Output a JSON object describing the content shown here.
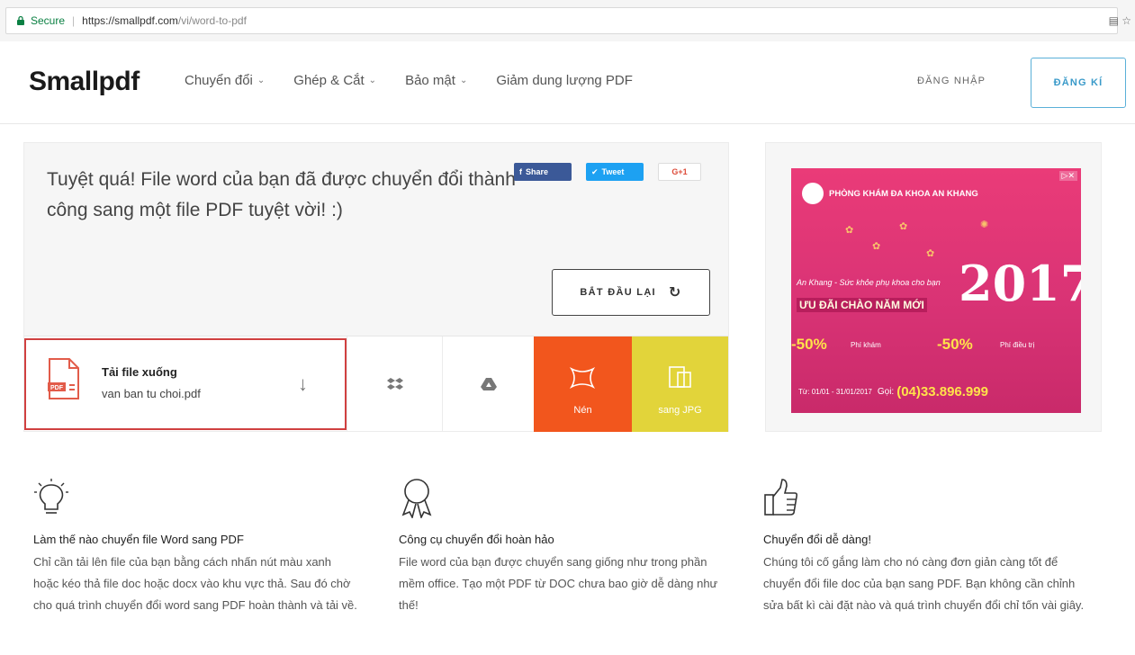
{
  "browser": {
    "secure_label": "Secure",
    "url_host": "https://smallpdf.com",
    "url_path": "/vi/word-to-pdf"
  },
  "header": {
    "logo": "Smallpdf",
    "nav": [
      {
        "label": "Chuyển đổi",
        "dropdown": true
      },
      {
        "label": "Ghép & Cắt",
        "dropdown": true
      },
      {
        "label": "Bảo mật",
        "dropdown": true
      },
      {
        "label": "Giảm dung lượng PDF",
        "dropdown": false
      }
    ],
    "login": "ĐĂNG NHẬP",
    "signup": "ĐĂNG KÍ"
  },
  "result": {
    "message": "Tuyệt quá! File word của bạn đã được chuyển đổi thành công sang một file PDF tuyệt vời! :)",
    "share": {
      "facebook": "Share",
      "twitter": "Tweet",
      "google": "G+1"
    },
    "restart_label": "BẮT ĐẦU LẠI",
    "download_title": "Tải file xuống",
    "file_name": "van ban tu choi.pdf",
    "compress_label": "Nén",
    "to_jpg_label": "sang JPG"
  },
  "ad": {
    "brand": "PHÒNG KHÁM ĐA KHOA AN KHANG",
    "tagline": "An Khang - Sức khỏe phụ khoa cho bạn",
    "promo": "ƯU ĐÃI CHÀO NĂM MỚI",
    "year": "2017",
    "discount1": "-50%",
    "discount1_note": "Phí khám",
    "discount2": "-50%",
    "discount2_note": "Phí điều trị",
    "dates": "Từ: 01/01 - 31/01/2017",
    "call_label": "Gọi:",
    "phone": "(04)33.896.999"
  },
  "features": [
    {
      "icon": "lightbulb-icon",
      "title": "Làm thế nào chuyển file Word sang PDF",
      "text": "Chỉ cần tải lên file của bạn bằng cách nhấn nút màu xanh hoặc kéo thả file doc hoặc docx vào khu vực thả. Sau đó chờ cho quá trình chuyển đổi word sang PDF hoàn thành và tải về."
    },
    {
      "icon": "award-ribbon-icon",
      "title": "Công cụ chuyển đổi hoàn hảo",
      "text": "File word của bạn được chuyển sang giống như trong phần mềm office. Tạo một PDF từ DOC chưa bao giờ dễ dàng như thế!"
    },
    {
      "icon": "thumbs-up-icon",
      "title": "Chuyển đổi dễ dàng!",
      "text": "Chúng tôi cố gắng làm cho nó càng đơn giản càng tốt để chuyển đổi file doc của bạn sang PDF. Bạn không cần chỉnh sửa bất kì cài đặt nào và quá trình chuyển đổi chỉ tốn vài giây."
    }
  ],
  "colors": {
    "compress": "#f2561d",
    "to_jpg": "#e2d43a",
    "signup_border": "#5ab0d8",
    "download_border": "#d04040",
    "ad_background": "#e0366f"
  }
}
